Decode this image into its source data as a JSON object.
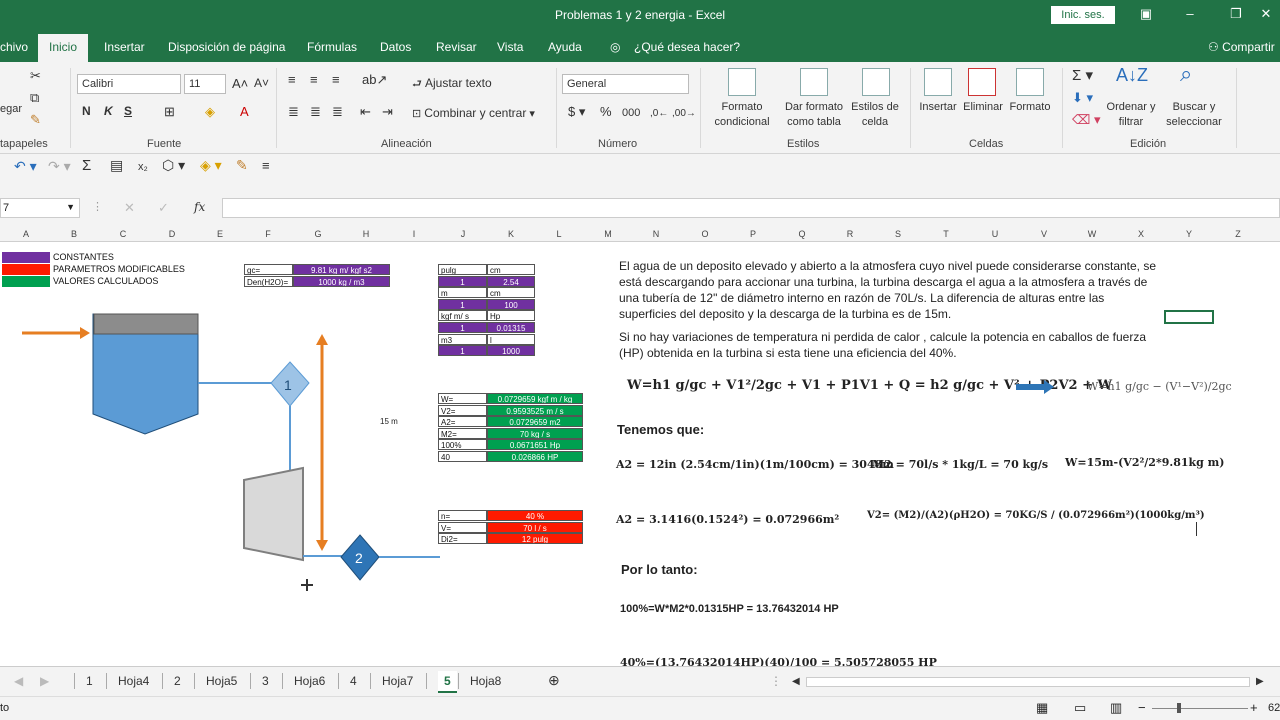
{
  "window": {
    "title": "Problemas 1 y 2 energia  -  Excel",
    "signin": "Inic. ses."
  },
  "ribbon_tabs": [
    "chivo",
    "Inicio",
    "Insertar",
    "Disposición de página",
    "Fórmulas",
    "Datos",
    "Revisar",
    "Vista",
    "Ayuda",
    "¿Qué desea hacer?",
    "Compartir"
  ],
  "ribbon": {
    "paste": "egar",
    "clipboard": "tapapeles",
    "font_name": "Calibri",
    "font_size": "11",
    "font_group": "Fuente",
    "wrap_text": "Ajustar texto",
    "merge_center": "Combinar y centrar",
    "align_group": "Alineación",
    "number_format": "General",
    "number_group": "Número",
    "cond_format": [
      "Formato",
      "condicional"
    ],
    "format_table": [
      "Dar formato",
      "como tabla"
    ],
    "cell_styles": [
      "Estilos de",
      "celda"
    ],
    "styles_group": "Estilos",
    "insert": "Insertar",
    "delete": "Eliminar",
    "format": "Formato",
    "cells_group": "Celdas",
    "sort": [
      "Ordenar y",
      "filtrar"
    ],
    "find": [
      "Buscar y",
      "seleccionar"
    ],
    "editing_group": "Edición"
  },
  "namebox": "7",
  "columns": [
    "A",
    "B",
    "C",
    "D",
    "E",
    "F",
    "G",
    "H",
    "I",
    "J",
    "K",
    "L",
    "M",
    "N",
    "O",
    "P",
    "Q",
    "R",
    "S",
    "T",
    "U",
    "V",
    "W",
    "X",
    "Y",
    "Z"
  ],
  "legend": [
    {
      "label": "CONSTANTES",
      "color": "#7030a0"
    },
    {
      "label": "PARAMETROS MODIFICABLES",
      "color": "#ff1a00"
    },
    {
      "label": "VALORES CALCULADOS",
      "color": "#00a050"
    }
  ],
  "constants": [
    [
      "gc=",
      "9.81 kg m/ kgf s2"
    ],
    [
      "Den(H2O)=",
      "1000 kg / m3"
    ]
  ],
  "conversions": [
    [
      "pulg",
      "cm"
    ],
    [
      "1",
      "2.54"
    ],
    [
      "m",
      "cm"
    ],
    [
      "1",
      "100"
    ],
    [
      "kgf m/ s",
      "Hp"
    ],
    [
      "1",
      "0.01315"
    ],
    [
      "m3",
      "l"
    ],
    [
      "1",
      "1000"
    ]
  ],
  "calculated": [
    [
      "W=",
      "0.0729659 kgf m / kg"
    ],
    [
      "V2=",
      "0.9593525 m / s"
    ],
    [
      "A2=",
      "0.0729659 m2"
    ],
    [
      "M2=",
      "70 kg / s"
    ],
    [
      "100%",
      "0.0671651 Hp"
    ],
    [
      "40",
      "0.026866 HP"
    ]
  ],
  "parameters": [
    [
      "n=",
      "40 %"
    ],
    [
      "V=",
      "70 l / s"
    ],
    [
      "Di2=",
      "12 pulg"
    ]
  ],
  "diagram": {
    "height_label": "15 m",
    "node1": "1",
    "node2": "2"
  },
  "problem": {
    "p1": "El agua de un deposito elevado y abierto a la atmosfera cuyo nivel puede considerarse constante, se está descargando para accionar una turbina, la turbina descarga el agua a la atmosfera a través de una tubería de 12\" de diámetro interno en razón de 70L/s. La diferencia de alturas entre las superficies del deposito y la descarga de la turbina es de 15m.",
    "p2": "Si no hay variaciones de temperatura ni perdida de calor , calcule la potencia en caballos de fuerza (HP) obtenida en la turbina si esta tiene una eficiencia del 40%."
  },
  "equations": {
    "energy": "W=h1 g/gc + V1²/2gc + V1 + P1V1 + Q = h2 g/gc + V² + P2V2 + W",
    "energy_simpl": "W=h1 g/gc − (V¹−V²)/2gc",
    "tenemos": "Tenemos que:",
    "a2_in": "A2 = 12in (2.54cm/1in)(1m/100cm) = 3048m",
    "m2": "M2 = 70l/s * 1kg/L = 70 kg/s",
    "w15": "W=15m-(V2²/2*9.81kg m)",
    "a2_area": "A2 = 3.1416(0.1524²) = 0.072966m²",
    "v2": "V2= (M2)/(A2)(ρH2O) = 70KG/S / (0.072966m²)(1000kg/m³)",
    "porlotanto": "Por lo tanto:",
    "r100": "100%=W*M2*0.01315HP = 13.76432014 HP",
    "r40": "40%=(13.76432014HP)(40)/100 = 5.505728055 HP"
  },
  "sheets": [
    "1",
    "Hoja4",
    "2",
    "Hoja5",
    "3",
    "Hoja6",
    "4",
    "Hoja7",
    "5",
    "Hoja8"
  ],
  "active_sheet": "5",
  "status": {
    "mode": "to",
    "zoom": "62"
  }
}
